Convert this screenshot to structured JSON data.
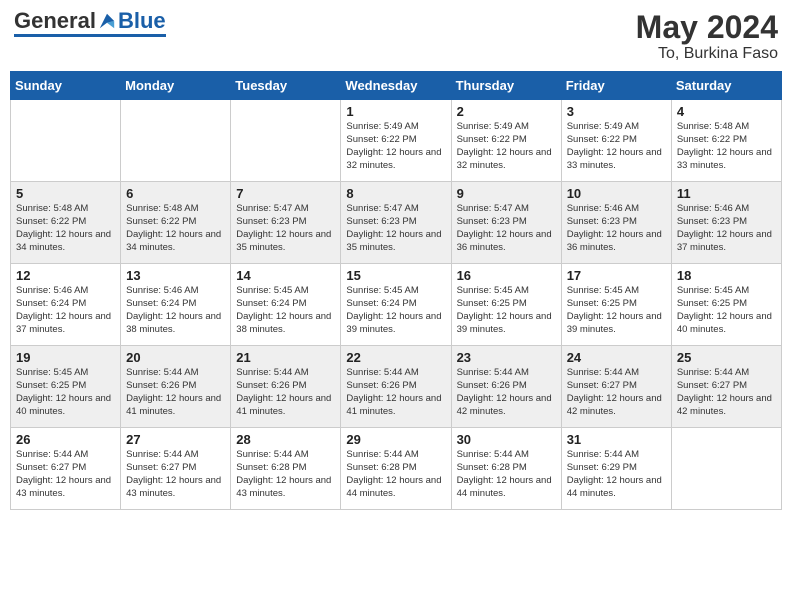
{
  "header": {
    "logo_general": "General",
    "logo_blue": "Blue",
    "month_year": "May 2024",
    "location": "To, Burkina Faso"
  },
  "weekdays": [
    "Sunday",
    "Monday",
    "Tuesday",
    "Wednesday",
    "Thursday",
    "Friday",
    "Saturday"
  ],
  "weeks": [
    {
      "row_class": "row-odd",
      "days": [
        {
          "date": "",
          "info": ""
        },
        {
          "date": "",
          "info": ""
        },
        {
          "date": "",
          "info": ""
        },
        {
          "date": "1",
          "info": "Sunrise: 5:49 AM\nSunset: 6:22 PM\nDaylight: 12 hours\nand 32 minutes."
        },
        {
          "date": "2",
          "info": "Sunrise: 5:49 AM\nSunset: 6:22 PM\nDaylight: 12 hours\nand 32 minutes."
        },
        {
          "date": "3",
          "info": "Sunrise: 5:49 AM\nSunset: 6:22 PM\nDaylight: 12 hours\nand 33 minutes."
        },
        {
          "date": "4",
          "info": "Sunrise: 5:48 AM\nSunset: 6:22 PM\nDaylight: 12 hours\nand 33 minutes."
        }
      ]
    },
    {
      "row_class": "row-even",
      "days": [
        {
          "date": "5",
          "info": "Sunrise: 5:48 AM\nSunset: 6:22 PM\nDaylight: 12 hours\nand 34 minutes."
        },
        {
          "date": "6",
          "info": "Sunrise: 5:48 AM\nSunset: 6:22 PM\nDaylight: 12 hours\nand 34 minutes."
        },
        {
          "date": "7",
          "info": "Sunrise: 5:47 AM\nSunset: 6:23 PM\nDaylight: 12 hours\nand 35 minutes."
        },
        {
          "date": "8",
          "info": "Sunrise: 5:47 AM\nSunset: 6:23 PM\nDaylight: 12 hours\nand 35 minutes."
        },
        {
          "date": "9",
          "info": "Sunrise: 5:47 AM\nSunset: 6:23 PM\nDaylight: 12 hours\nand 36 minutes."
        },
        {
          "date": "10",
          "info": "Sunrise: 5:46 AM\nSunset: 6:23 PM\nDaylight: 12 hours\nand 36 minutes."
        },
        {
          "date": "11",
          "info": "Sunrise: 5:46 AM\nSunset: 6:23 PM\nDaylight: 12 hours\nand 37 minutes."
        }
      ]
    },
    {
      "row_class": "row-odd",
      "days": [
        {
          "date": "12",
          "info": "Sunrise: 5:46 AM\nSunset: 6:24 PM\nDaylight: 12 hours\nand 37 minutes."
        },
        {
          "date": "13",
          "info": "Sunrise: 5:46 AM\nSunset: 6:24 PM\nDaylight: 12 hours\nand 38 minutes."
        },
        {
          "date": "14",
          "info": "Sunrise: 5:45 AM\nSunset: 6:24 PM\nDaylight: 12 hours\nand 38 minutes."
        },
        {
          "date": "15",
          "info": "Sunrise: 5:45 AM\nSunset: 6:24 PM\nDaylight: 12 hours\nand 39 minutes."
        },
        {
          "date": "16",
          "info": "Sunrise: 5:45 AM\nSunset: 6:25 PM\nDaylight: 12 hours\nand 39 minutes."
        },
        {
          "date": "17",
          "info": "Sunrise: 5:45 AM\nSunset: 6:25 PM\nDaylight: 12 hours\nand 39 minutes."
        },
        {
          "date": "18",
          "info": "Sunrise: 5:45 AM\nSunset: 6:25 PM\nDaylight: 12 hours\nand 40 minutes."
        }
      ]
    },
    {
      "row_class": "row-even",
      "days": [
        {
          "date": "19",
          "info": "Sunrise: 5:45 AM\nSunset: 6:25 PM\nDaylight: 12 hours\nand 40 minutes."
        },
        {
          "date": "20",
          "info": "Sunrise: 5:44 AM\nSunset: 6:26 PM\nDaylight: 12 hours\nand 41 minutes."
        },
        {
          "date": "21",
          "info": "Sunrise: 5:44 AM\nSunset: 6:26 PM\nDaylight: 12 hours\nand 41 minutes."
        },
        {
          "date": "22",
          "info": "Sunrise: 5:44 AM\nSunset: 6:26 PM\nDaylight: 12 hours\nand 41 minutes."
        },
        {
          "date": "23",
          "info": "Sunrise: 5:44 AM\nSunset: 6:26 PM\nDaylight: 12 hours\nand 42 minutes."
        },
        {
          "date": "24",
          "info": "Sunrise: 5:44 AM\nSunset: 6:27 PM\nDaylight: 12 hours\nand 42 minutes."
        },
        {
          "date": "25",
          "info": "Sunrise: 5:44 AM\nSunset: 6:27 PM\nDaylight: 12 hours\nand 42 minutes."
        }
      ]
    },
    {
      "row_class": "row-odd",
      "days": [
        {
          "date": "26",
          "info": "Sunrise: 5:44 AM\nSunset: 6:27 PM\nDaylight: 12 hours\nand 43 minutes."
        },
        {
          "date": "27",
          "info": "Sunrise: 5:44 AM\nSunset: 6:27 PM\nDaylight: 12 hours\nand 43 minutes."
        },
        {
          "date": "28",
          "info": "Sunrise: 5:44 AM\nSunset: 6:28 PM\nDaylight: 12 hours\nand 43 minutes."
        },
        {
          "date": "29",
          "info": "Sunrise: 5:44 AM\nSunset: 6:28 PM\nDaylight: 12 hours\nand 44 minutes."
        },
        {
          "date": "30",
          "info": "Sunrise: 5:44 AM\nSunset: 6:28 PM\nDaylight: 12 hours\nand 44 minutes."
        },
        {
          "date": "31",
          "info": "Sunrise: 5:44 AM\nSunset: 6:29 PM\nDaylight: 12 hours\nand 44 minutes."
        },
        {
          "date": "",
          "info": ""
        }
      ]
    }
  ]
}
